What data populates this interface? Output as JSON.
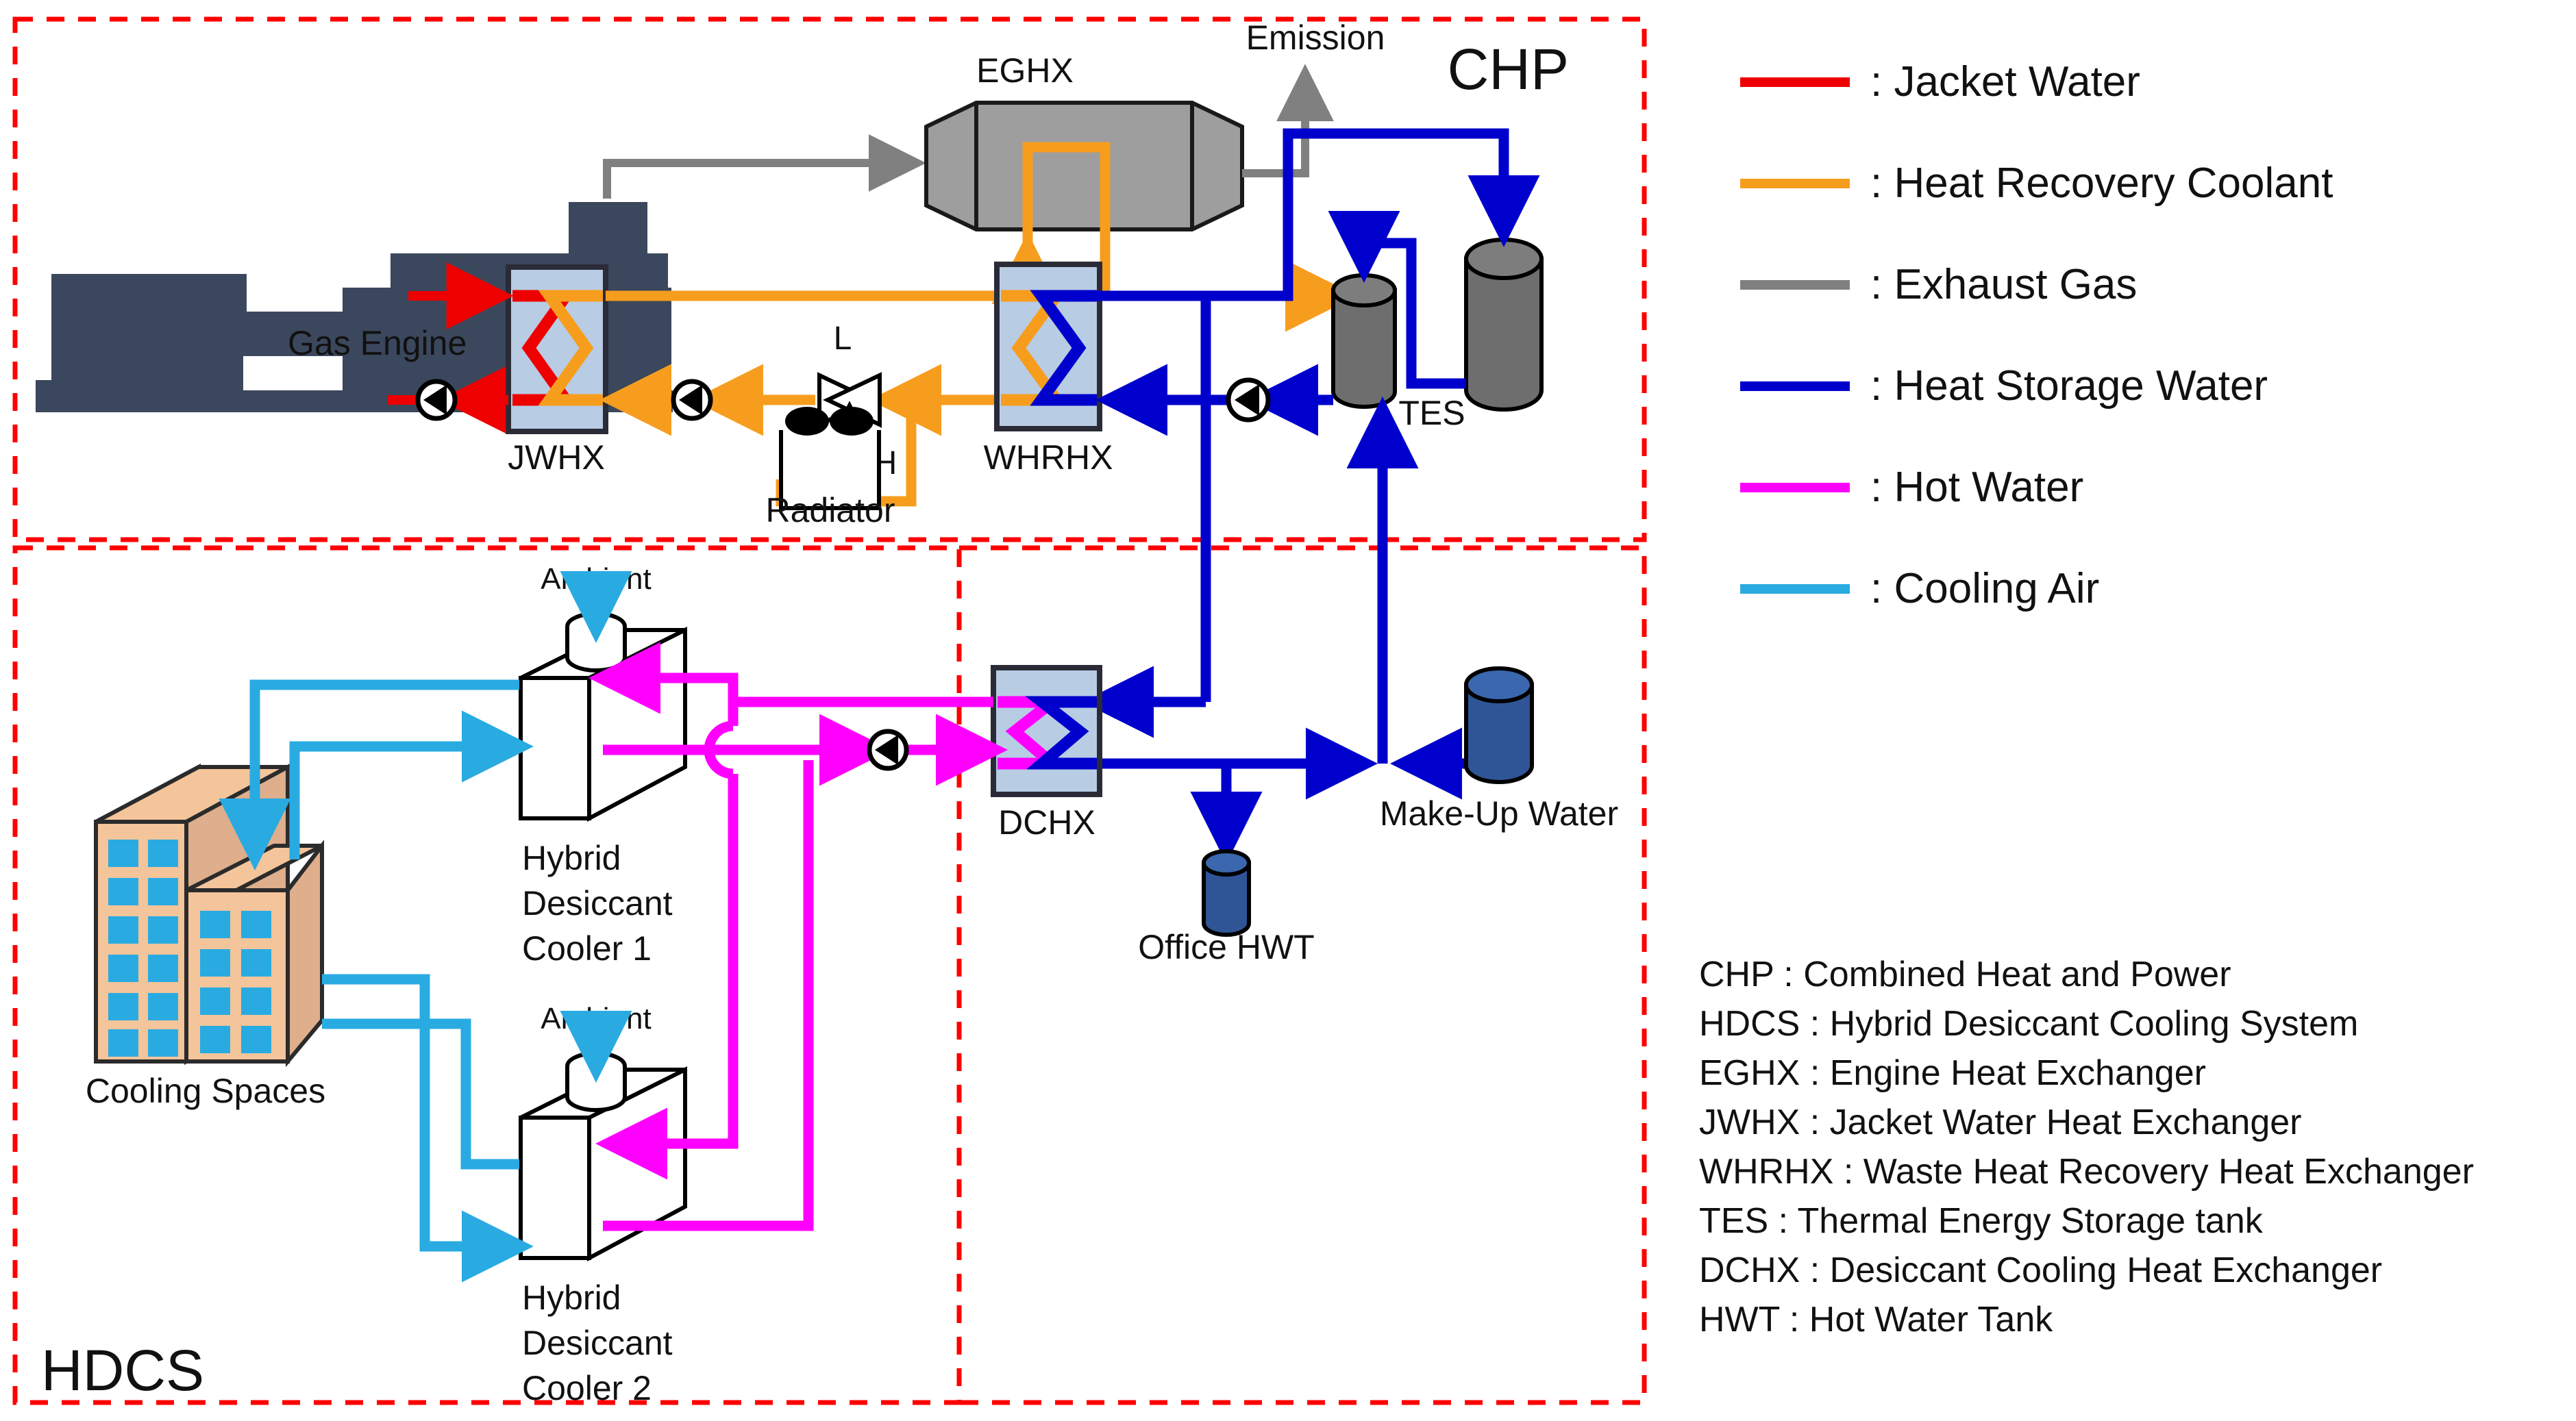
{
  "diagram": {
    "title_chp": "CHP",
    "title_hdcs": "HDCS"
  },
  "chp": {
    "gas_engine": "Gas Engine",
    "eghx": "EGHX",
    "emission": "Emission",
    "jwhx": "JWHX",
    "whrhx": "WHRHX",
    "radiator": "Radiator",
    "tes": "TES",
    "valve_low": "L",
    "valve_high": "H"
  },
  "hdcs": {
    "cooling_spaces": "Cooling Spaces",
    "ambient_1": "Ambient",
    "ambient_2": "Ambient",
    "cooler1_line1": "Hybrid",
    "cooler1_line2": "Desiccant",
    "cooler1_line3": "Cooler 1",
    "cooler2_line1": "Hybrid",
    "cooler2_line2": "Desiccant",
    "cooler2_line3": "Cooler 2",
    "dchx": "DCHX",
    "office_hwt": "Office HWT",
    "makeup_water": "Make-Up Water"
  },
  "legend": {
    "items": [
      {
        "label": ": Jacket Water",
        "color": "#ee0000"
      },
      {
        "label": ": Heat Recovery Coolant",
        "color": "#f79d1e"
      },
      {
        "label": ": Exhaust Gas",
        "color": "#808080"
      },
      {
        "label": ": Heat Storage Water",
        "color": "#0000cc"
      },
      {
        "label": ": Hot Water",
        "color": "#ff00ff"
      },
      {
        "label": ": Cooling Air",
        "color": "#29abe2"
      }
    ]
  },
  "abbreviations": {
    "items": [
      "CHP : Combined Heat and Power",
      "HDCS : Hybrid Desiccant Cooling System",
      "EGHX : Engine Heat Exchanger",
      "JWHX : Jacket Water Heat Exchanger",
      "WHRHX : Waste Heat Recovery Heat Exchanger",
      "TES : Thermal Energy Storage tank",
      "DCHX : Desiccant Cooling Heat Exchanger",
      "HWT : Hot Water Tank"
    ]
  },
  "colors": {
    "jacket_water": "#ee0000",
    "heat_recovery_coolant": "#f79d1e",
    "exhaust_gas": "#808080",
    "heat_storage_water": "#0000cc",
    "hot_water": "#ff00ff",
    "cooling_air": "#29abe2",
    "boundary": "#ff0000",
    "hx_fill": "#b8cce4",
    "engine_fill": "#3b475c",
    "tank_gray": "#6e6e6e",
    "tank_blue": "#2f5597",
    "building": "#f4c49a"
  }
}
